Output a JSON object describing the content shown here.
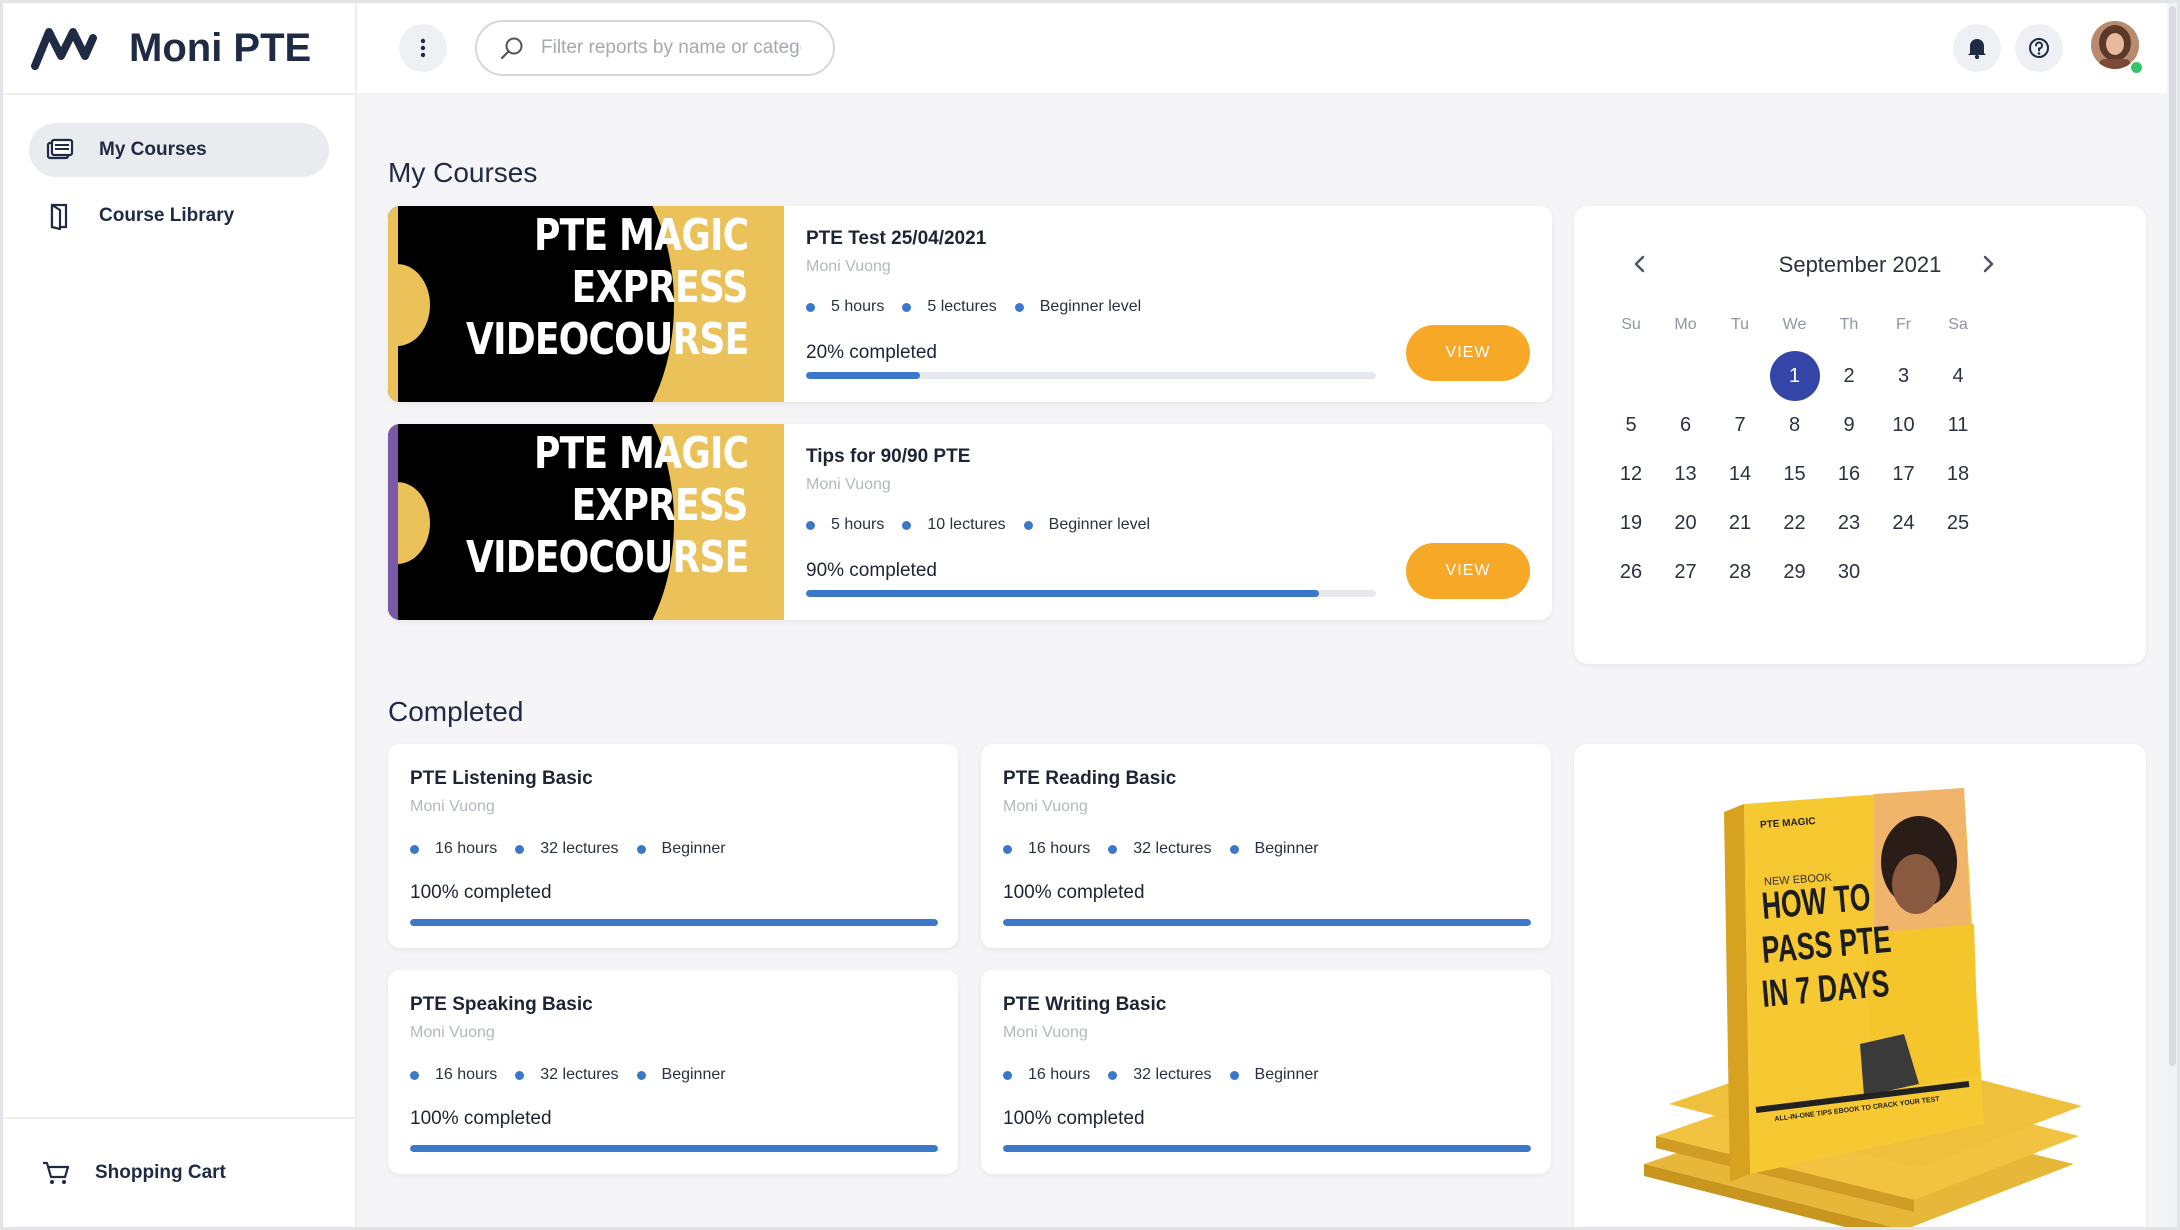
{
  "app": {
    "name": "Moni PTE"
  },
  "sidebar": {
    "items": [
      {
        "label": "My Courses",
        "icon": "courses-icon",
        "active": true
      },
      {
        "label": "Course Library",
        "icon": "library-icon",
        "active": false
      }
    ],
    "bottom": {
      "label": "Shopping Cart",
      "icon": "cart-icon"
    }
  },
  "header": {
    "search_placeholder": "Filter reports by name or category",
    "search_value": ""
  },
  "main": {
    "my_courses_title": "My Courses",
    "completed_title": "Completed",
    "courses": [
      {
        "title": "PTE Test 25/04/2021",
        "author": "Moni Vuong",
        "hours": "5 hours",
        "lectures": "5 lectures",
        "level": "Beginner level",
        "progress_text": "20% completed",
        "progress": 0.2,
        "button": "VIEW",
        "stripe_color": "#ebc25a",
        "thumb": {
          "l1": "PTE MAGIC",
          "l2": "EXPRESS",
          "l3": "VIDEOCOURSE"
        }
      },
      {
        "title": "Tips for 90/90 PTE",
        "author": "Moni Vuong",
        "hours": "5 hours",
        "lectures": "10 lectures",
        "level": "Beginner level",
        "progress_text": "90% completed",
        "progress": 0.9,
        "button": "VIEW",
        "stripe_color": "#7a5aa6",
        "thumb": {
          "l1": "PTE MAGIC",
          "l2": "EXPRESS",
          "l3": "VIDEOCOURSE"
        }
      }
    ],
    "completed": [
      {
        "title": "PTE Listening Basic",
        "author": "Moni Vuong",
        "hours": "16 hours",
        "lectures": "32 lectures",
        "level": "Beginner",
        "progress_text": "100% completed",
        "progress": 1.0
      },
      {
        "title": "PTE Reading Basic",
        "author": "Moni Vuong",
        "hours": "16 hours",
        "lectures": "32 lectures",
        "level": "Beginner",
        "progress_text": "100% completed",
        "progress": 1.0
      },
      {
        "title": "PTE Speaking Basic",
        "author": "Moni Vuong",
        "hours": "16 hours",
        "lectures": "32 lectures",
        "level": "Beginner",
        "progress_text": "100% completed",
        "progress": 1.0
      },
      {
        "title": "PTE Writing Basic",
        "author": "Moni Vuong",
        "hours": "16 hours",
        "lectures": "32 lectures",
        "level": "Beginner",
        "progress_text": "100% completed",
        "progress": 1.0
      }
    ]
  },
  "calendar": {
    "month": "September 2021",
    "weekdays": [
      "Su",
      "Mo",
      "Tu",
      "We",
      "Th",
      "Fr",
      "Sa"
    ],
    "first_weekday": 3,
    "days_in_month": 30,
    "selected": 1
  },
  "promo": {
    "brand": "PTE MAGIC",
    "tag": "NEW EBOOK",
    "headline": [
      "HOW TO",
      "PASS PTE",
      "IN 7 DAYS"
    ],
    "footer": "ALL-IN-ONE TIPS EBOOK TO CRACK YOUR TEST"
  },
  "colors": {
    "accent": "#3b78c9",
    "button": "#f7a826",
    "calendar_selected": "#3346a8",
    "thumb_yellow": "#ebc25a"
  }
}
